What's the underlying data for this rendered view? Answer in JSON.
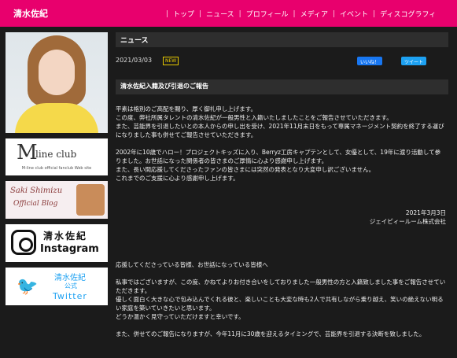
{
  "header": {
    "site_title": "清水佐紀",
    "nav": [
      "トップ",
      "ニュース",
      "プロフィール",
      "メディア",
      "イベント",
      "ディスコグラフィ"
    ]
  },
  "sidebar": {
    "banners": {
      "mline": {
        "logo": "M",
        "title": "line club",
        "sub": "M-line club official fanclub Web site"
      },
      "blog": {
        "line1": "Saki Shimizu",
        "line2": "Official Blog"
      },
      "instagram": {
        "name": "清水佐紀",
        "label": "Instagram"
      },
      "twitter": {
        "name": "清水佐紀",
        "sub": "公式",
        "label": "Twitter"
      }
    }
  },
  "main": {
    "section_title": "ニュース",
    "date": "2021/03/03",
    "new_badge": "NEW",
    "like_button": "いいね！",
    "tweet_button": "ツイート",
    "article_title": "清水佐紀入籍及び引退のご報告",
    "paragraphs": [
      "平素は格別のご高配を賜り、厚く御礼申し上げます。",
      "この度、弊社所属タレントの清水佐紀が一般男性と入籍いたしましたことをご報告させていただきます。",
      "また、芸能界を引退したいとの本人からの申し出を受け、2021年11月末日をもって専属マネージメント契約を終了する運びになりました事も併せてご報告させていただきます。",
      "",
      "2002年に10歳でハロー！プロジェクトキッズに入り、Berryz工房キャプテンとして、女優として、19年に渡り活動して参りました。お世話になった関係者の皆さまのご厚情に心より感謝申し上げます。",
      "また、長い間応援してくださったファンの皆さまには突然の発表となり大変申し訳ございません。",
      "これまでのご支援に心より感謝申し上げます。",
      "",
      "",
      "2021年3月3日",
      "ジェイピィールーム株式会社",
      "",
      "",
      "",
      "応援してくださっている皆様、お世話になっている皆様へ",
      "",
      "私事ではございますが、この度、かねてよりお付き合いをしておりました一般男性の方と入籍致しました事をご報告させていただきます。",
      "優しく面白く大きな心で包み込んでくれる彼と、楽しいことも大変な時も2人で共有しながら乗り越え、笑いの絶えない明るい家庭を築いていきたいと思います。",
      "どうか温かく見守っていただけますと幸いです。",
      "",
      "また、併せてのご報告になりますが、今年11月に30歳を迎えるタイミングで、芸能界を引退する決断を致しました。"
    ]
  }
}
